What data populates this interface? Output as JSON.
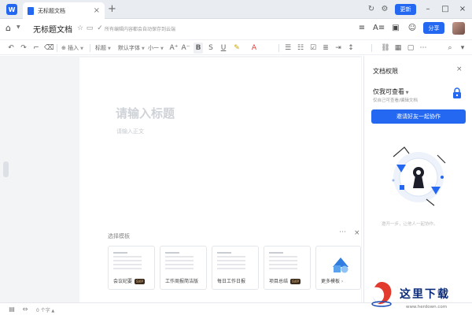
{
  "tabbar": {
    "app_logo": "W",
    "tab_title": "无标题文档",
    "tab_close": "×",
    "tab_add": "+",
    "update_label": "更新",
    "history_icon": "history-icon",
    "settings_icon": "settings-icon",
    "minimize": "–",
    "maximize": "□",
    "close": "×"
  },
  "docbar": {
    "doc_title": "无标题文档",
    "save_status": "所有编辑内容都会自动保存到云端",
    "share_label": "分享"
  },
  "toolbar": {
    "insert_label": "插入",
    "heading_label": "标题",
    "font_label": "默认字体",
    "size_label": "小一"
  },
  "editor": {
    "title_placeholder": "请输入标题",
    "body_placeholder": "请输入正文"
  },
  "templates": {
    "section_label": "选择模板",
    "items": [
      {
        "name": "会议纪要",
        "badge": "SVIP"
      },
      {
        "name": "工作周报简洁版",
        "badge": ""
      },
      {
        "name": "每日工作日报",
        "badge": ""
      },
      {
        "name": "项目总结",
        "badge": "SVIP"
      },
      {
        "name": "更多模板",
        "badge": ""
      }
    ]
  },
  "panel": {
    "title": "文档权限",
    "permission": "仅我可查看",
    "permission_sub": "仅自己可查看/编辑文档",
    "invite_label": "邀请好友一起协作",
    "hint": "邀开一步，让他人一起协作。"
  },
  "statusbar": {
    "word_count": "0 个字"
  },
  "watermark": {
    "text": "这里下载",
    "url": "www.herdown.com"
  },
  "colors": {
    "accent": "#2468f2",
    "workspace_bg": "#f3f4f6"
  }
}
